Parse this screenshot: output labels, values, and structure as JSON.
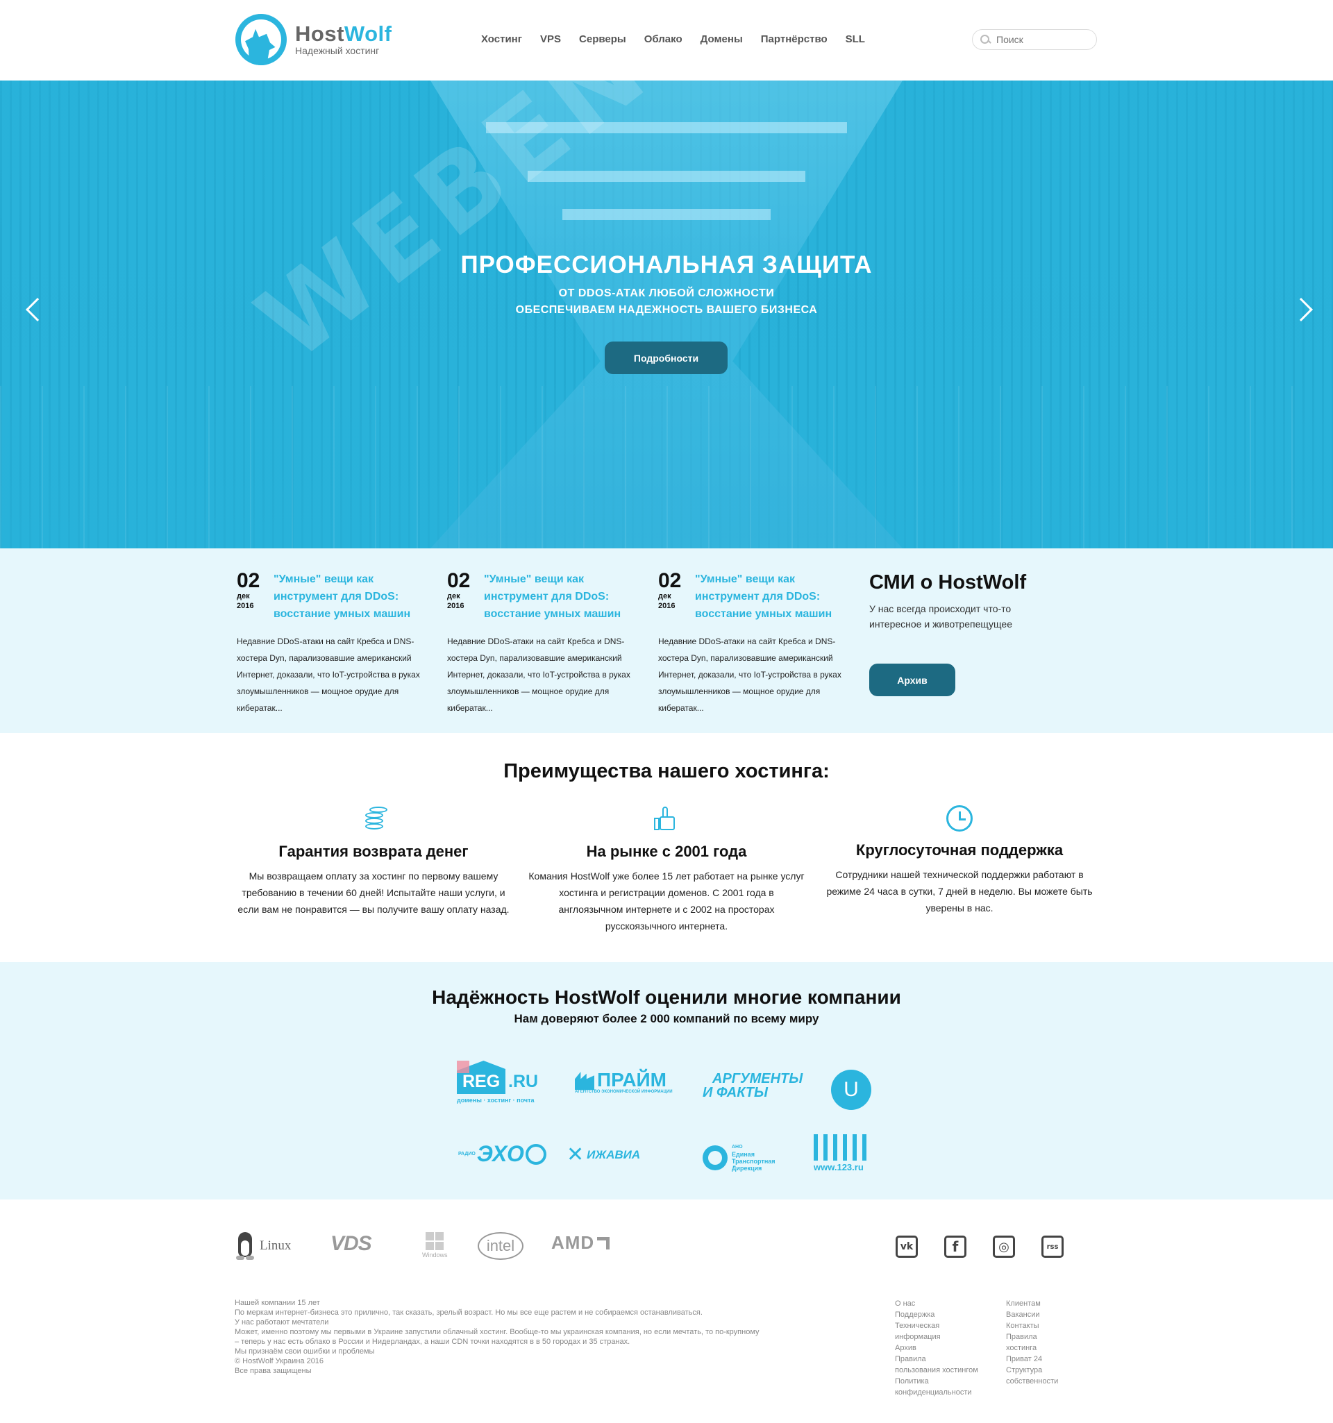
{
  "header": {
    "logo_name_part1": "Host",
    "logo_name_part2": "Wolf",
    "logo_tagline": "Надежный хостинг",
    "nav": [
      "Хостинг",
      "VPS",
      "Серверы",
      "Облако",
      "Домены",
      "Партнёрство",
      "SLL"
    ],
    "search_placeholder": "Поиск"
  },
  "hero": {
    "watermark": "WEBENVY.COM",
    "title": "ПРОФЕССИОНАЛЬНАЯ ЗАЩИТА",
    "subtitle_line1": "ОТ DDOS-АТАК ЛЮБОЙ СЛОЖНОСТИ",
    "subtitle_line2": "ОБЕСПЕЧИВАЕМ НАДЕЖНОСТЬ ВАШЕГО БИЗНЕСА",
    "button": "Подробности"
  },
  "news": [
    {
      "day": "02",
      "month": "дек",
      "year": "2016",
      "title": "\"Умные\" вещи как инструмент для DDoS: восстание умных машин",
      "text": "Недавние DDoS-атаки на сайт Кребса и DNS-хостера Dyn, парализовавшие американский Интернет, доказали, что IoT-устройства в руках злоумышленников — мощное орудие для кибератак..."
    },
    {
      "day": "02",
      "month": "дек",
      "year": "2016",
      "title": "\"Умные\" вещи как инструмент для DDoS: восстание умных машин",
      "text": "Недавние DDoS-атаки на сайт Кребса и DNS-хостера Dyn, парализовавшие американский Интернет, доказали, что IoT-устройства в руках злоумышленников — мощное орудие для кибератак..."
    },
    {
      "day": "02",
      "month": "дек",
      "year": "2016",
      "title": "\"Умные\" вещи как инструмент для DDoS: восстание умных машин",
      "text": "Недавние DDoS-атаки на сайт Кребса и DNS-хостера Dyn, парализовавшие американский Интернет, доказали, что IoT-устройства в руках злоумышленников — мощное орудие для кибератак..."
    }
  ],
  "media": {
    "title": "СМИ о HostWolf",
    "text": "У нас всегда происходит что-то интересное и животрепещущее",
    "button": "Архив"
  },
  "advantages": {
    "heading": "Преимущества нашего хостинга:",
    "items": [
      {
        "icon": "coins-icon",
        "title": "Гарантия возврата денег",
        "text": "Мы возвращаем оплату за хостинг по первому вашему требованию в течении 60 дней! Испытайте наши услуги, и если вам не понравится — вы получите вашу оплату назад."
      },
      {
        "icon": "thumbs-up-icon",
        "title": "На рынке с 2001 года",
        "text": "Комания HostWolf уже более 15 лет работает на рынке услуг хостинга и регистрации доменов. С 2001 года в англоязычном интернете и с 2002 на просторах русскоязычного интернета."
      },
      {
        "icon": "clock-icon",
        "title": "Круглосуточная поддержка",
        "text": "Сотрудники нашей технической поддержки работают в режиме 24 часа в сутки, 7 дней в неделю. Вы можете быть уверены в нас."
      }
    ]
  },
  "clients": {
    "title": "Надёжность HostWolf оценили многие компании",
    "subtitle": "Нам доверяют более 2 000 компаний по всему миру",
    "logos": {
      "reg_main": "REG",
      "reg_suffix": ".RU",
      "reg_tagline": "домены · хостинг · почта",
      "prime_main": "ПРАЙМ",
      "prime_tagline": "АГЕНТСТВО ЭКОНОМИЧЕСКОЙ ИНФОРМАЦИИ",
      "af_line1": "АРГУМЕНТЫ",
      "af_line2": "И ФАКТЫ",
      "u_letter": "U",
      "echo_main": "ЭХО",
      "echo_small": "РАДИО",
      "izhavia": "ИЖАВИА",
      "etd_line1": "АНО",
      "etd_line2": "Единая",
      "etd_line3": "Транспортная",
      "etd_line4": "Дирекция",
      "www123": "www.123.ru"
    }
  },
  "tech_logos": {
    "linux": "Linux",
    "vds": "VDS",
    "windows": "Windows",
    "intel": "intel",
    "amd": "AMD"
  },
  "social": {
    "vk": "vk",
    "facebook": "f",
    "instagram": "◎",
    "rss": "rss"
  },
  "footer": {
    "lines": [
      "Нашей компании 15 лет",
      "По меркам интернет-бизнеса это прилично, так сказать, зрелый возраст. Но мы все еще растем и не собираемся останавливаться.",
      "У нас работают мечтатели",
      "Может, именно поэтому мы первыми в Украине запустили облачный хостинг. Вообще-то мы украинская компания, но если мечтать, то по-крупному",
      "– теперь у нас есть облако в России и Нидерландах, а наши CDN точки находятся в в 50 городах и 35 странах.",
      "Мы признаём свои ошибки и проблемы",
      "© HostWolf Украина 2016",
      "Все права защищены"
    ],
    "col1": [
      "О нас",
      "Поддержка",
      "Техническая",
      "информация",
      "Архив",
      "Правила",
      "пользования хостингом",
      "Политика",
      "конфиденциальности"
    ],
    "col2": [
      "Клиентам",
      "Вакансии",
      "Контакты",
      "Правила",
      "хостинга",
      "Приват 24",
      "Структура",
      "собственности"
    ]
  }
}
